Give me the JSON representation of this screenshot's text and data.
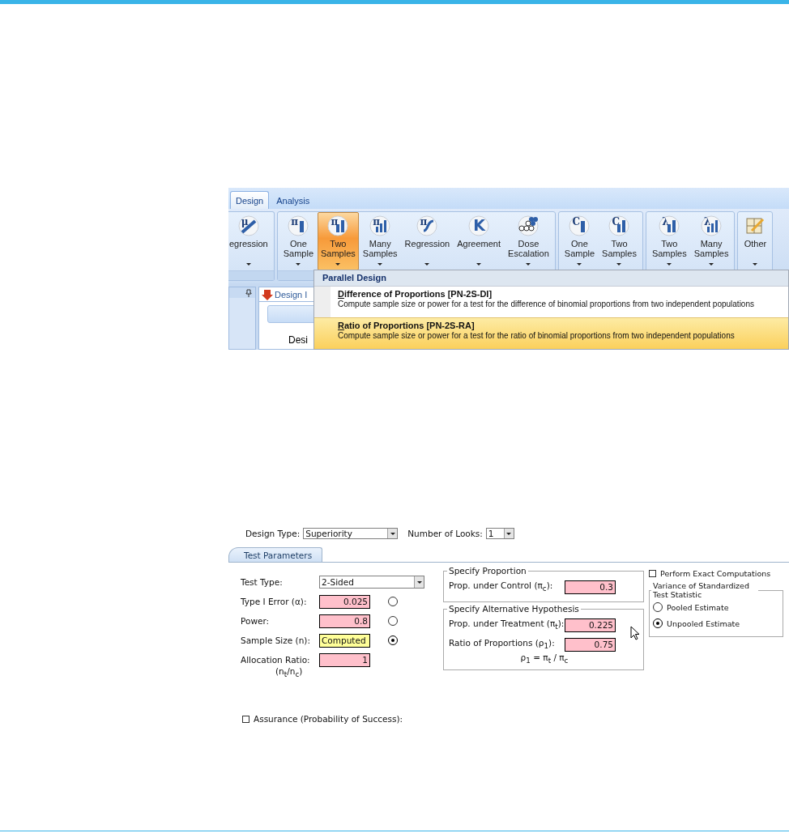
{
  "ribbon_tabs": [
    {
      "label": "Design",
      "selected": true
    },
    {
      "label": "Analysis",
      "selected": false
    }
  ],
  "ribbon_groups": [
    {
      "buttons": [
        {
          "label": "egression",
          "glyph": "μ",
          "kind": "line",
          "selected": false
        }
      ]
    },
    {
      "buttons": [
        {
          "label": "One Sample",
          "glyph": "π",
          "kind": "bar1",
          "selected": false
        },
        {
          "label": "Two Samples",
          "glyph": "π",
          "kind": "bars",
          "selected": true
        },
        {
          "label": "Many Samples",
          "glyph": "π",
          "kind": "bars3",
          "selected": false
        },
        {
          "label": "Regression",
          "glyph": "π",
          "kind": "curve",
          "selected": false
        },
        {
          "label": "Agreement",
          "glyph": "K",
          "kind": "letter",
          "selected": false
        },
        {
          "label": "Dose Escalation",
          "kind": "dots",
          "selected": false
        }
      ]
    },
    {
      "buttons": [
        {
          "label": "One Sample",
          "glyph": "C",
          "kind": "bar1",
          "selected": false
        },
        {
          "label": "Two Samples",
          "glyph": "C",
          "kind": "bars",
          "selected": false
        }
      ]
    },
    {
      "buttons": [
        {
          "label": "Two Samples",
          "glyph": "λ",
          "kind": "bars",
          "selected": false
        },
        {
          "label": "Many Samples",
          "glyph": "λ",
          "kind": "bars3",
          "selected": false
        }
      ]
    },
    {
      "buttons": [
        {
          "label": "Other",
          "kind": "pencil",
          "selected": false
        }
      ]
    }
  ],
  "workspace": {
    "document_tab": "Design I",
    "heading": "Desi"
  },
  "menu": {
    "header": "Parallel Design",
    "items": [
      {
        "title": "Difference of Proportions [PN-2S-DI]",
        "description": "Compute sample size or power for a test for the difference of binomial proportions from two independent populations",
        "selected": false
      },
      {
        "title": "Ratio of Proportions [PN-2S-RA]",
        "description": "Compute sample size or power for a test for the ratio of binomial proportions from two independent populations",
        "selected": true
      }
    ]
  },
  "design_row": {
    "design_type_label": "Design Type:",
    "design_type": "Superiority",
    "looks_label": "Number of Looks:",
    "looks": "1"
  },
  "tabs": [
    {
      "label": "Test Parameters"
    }
  ],
  "parameters": [
    {
      "label": "Test Type:",
      "kind": "select",
      "value": "2-Sided"
    },
    {
      "label": "Type I Error (α):",
      "kind": "input",
      "value": "0.025",
      "selected": false
    },
    {
      "label": "Power:",
      "kind": "input",
      "value": "0.8",
      "selected": false
    },
    {
      "label": "Sample Size (n):",
      "kind": "computed",
      "value": "Computed",
      "selected": true
    },
    {
      "label": "Allocation Ratio:",
      "kind": "input",
      "value": "1",
      "note": "(n$_{t}$/n$_{c}$)"
    }
  ],
  "specify_proportion": {
    "title": "Specify Proportion",
    "fields": [
      {
        "label": "Prop. under Control (π$_{c}$):",
        "value": "0.3"
      }
    ]
  },
  "alternative_hypothesis": {
    "title": "Specify Alternative Hypothesis",
    "fields": [
      {
        "label": "Prop. under Treatment (π$_{t}$):",
        "value": "0.225"
      },
      {
        "label": "Ratio of Proportions (ρ$_{1}$):",
        "value": "0.75"
      }
    ],
    "formula": "ρ$_{1}$ = π$_{t}$ / π$_{c}$"
  },
  "exact_computations": {
    "label": "Perform Exact Computations",
    "checked": false
  },
  "variance": {
    "title": "Variance of Standardized Test Statistic",
    "options": [
      {
        "label": "Pooled Estimate",
        "selected": false
      },
      {
        "label": "Unpooled Estimate",
        "selected": true
      }
    ]
  },
  "assurance": {
    "label": "Assurance (Probability of Success):",
    "checked": false
  }
}
